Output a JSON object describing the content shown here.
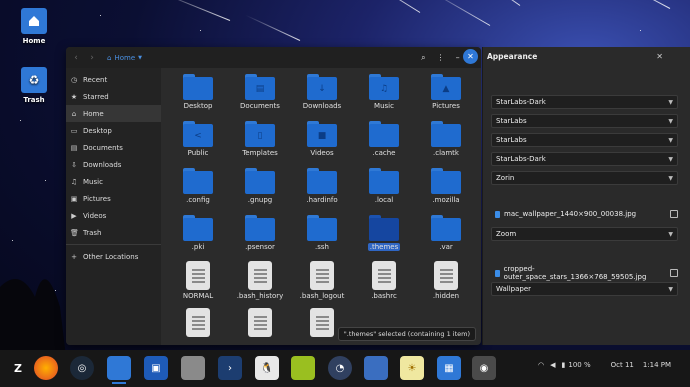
{
  "desktop": {
    "icons": [
      {
        "label": "Home"
      },
      {
        "label": "Trash"
      }
    ]
  },
  "file_manager": {
    "path_label": "Home",
    "sidebar": [
      {
        "icon": "clock-icon",
        "label": "Recent"
      },
      {
        "icon": "star-icon",
        "label": "Starred"
      },
      {
        "icon": "home-icon",
        "label": "Home"
      },
      {
        "icon": "desktop-icon",
        "label": "Desktop"
      },
      {
        "icon": "document-icon",
        "label": "Documents"
      },
      {
        "icon": "download-icon",
        "label": "Downloads"
      },
      {
        "icon": "music-icon",
        "label": "Music"
      },
      {
        "icon": "picture-icon",
        "label": "Pictures"
      },
      {
        "icon": "video-icon",
        "label": "Videos"
      },
      {
        "icon": "trash-icon",
        "label": "Trash"
      },
      {
        "icon": "plus-icon",
        "label": "Other Locations"
      }
    ],
    "items": [
      {
        "name": "Desktop",
        "type": "folder",
        "glyph": ""
      },
      {
        "name": "Documents",
        "type": "folder",
        "glyph": "▤"
      },
      {
        "name": "Downloads",
        "type": "folder",
        "glyph": "↓"
      },
      {
        "name": "Music",
        "type": "folder",
        "glyph": "♫"
      },
      {
        "name": "Pictures",
        "type": "folder",
        "glyph": "▲"
      },
      {
        "name": "Public",
        "type": "folder",
        "glyph": "<"
      },
      {
        "name": "Templates",
        "type": "folder",
        "glyph": "▯"
      },
      {
        "name": "Videos",
        "type": "folder",
        "glyph": "■"
      },
      {
        "name": ".cache",
        "type": "folder",
        "glyph": ""
      },
      {
        "name": ".clamtk",
        "type": "folder",
        "glyph": ""
      },
      {
        "name": ".config",
        "type": "folder",
        "glyph": ""
      },
      {
        "name": ".gnupg",
        "type": "folder",
        "glyph": ""
      },
      {
        "name": ".hardinfo",
        "type": "folder",
        "glyph": ""
      },
      {
        "name": ".local",
        "type": "folder",
        "glyph": ""
      },
      {
        "name": ".mozilla",
        "type": "folder",
        "glyph": ""
      },
      {
        "name": ".pki",
        "type": "folder",
        "glyph": ""
      },
      {
        "name": ".psensor",
        "type": "folder",
        "glyph": ""
      },
      {
        "name": ".ssh",
        "type": "folder",
        "glyph": ""
      },
      {
        "name": ".themes",
        "type": "folder",
        "glyph": "",
        "selected": true
      },
      {
        "name": ".var",
        "type": "folder",
        "glyph": ""
      },
      {
        "name": "NORMAL",
        "type": "file"
      },
      {
        "name": ".bash_history",
        "type": "file"
      },
      {
        "name": ".bash_logout",
        "type": "file"
      },
      {
        "name": ".bashrc",
        "type": "file"
      },
      {
        "name": ".hidden",
        "type": "file"
      },
      {
        "name": "",
        "type": "file"
      },
      {
        "name": "",
        "type": "file"
      },
      {
        "name": "",
        "type": "file"
      }
    ],
    "status": "\".themes\" selected (containing 1 item)"
  },
  "appearance": {
    "title": "Appearance",
    "selects": [
      {
        "value": "StarLabs-Dark"
      },
      {
        "value": "StarLabs"
      },
      {
        "value": "StarLabs"
      },
      {
        "value": "StarLabs-Dark"
      },
      {
        "value": "Zorin"
      }
    ],
    "background_file": "mac_wallpaper_1440×900_00038.jpg",
    "background_mode": "Zoom",
    "lock_file": "cropped-outer_space_stars_1366×768_59505.jpg",
    "lock_mode": "Wallpaper"
  },
  "tray": {
    "battery": "100 %",
    "date": "Oct 11",
    "time": "1:14 PM"
  },
  "colors": {
    "accent": "#2f78d6",
    "folder": "#1f6bcf",
    "panel": "#2a2a2a",
    "taskbar": "#171717"
  }
}
